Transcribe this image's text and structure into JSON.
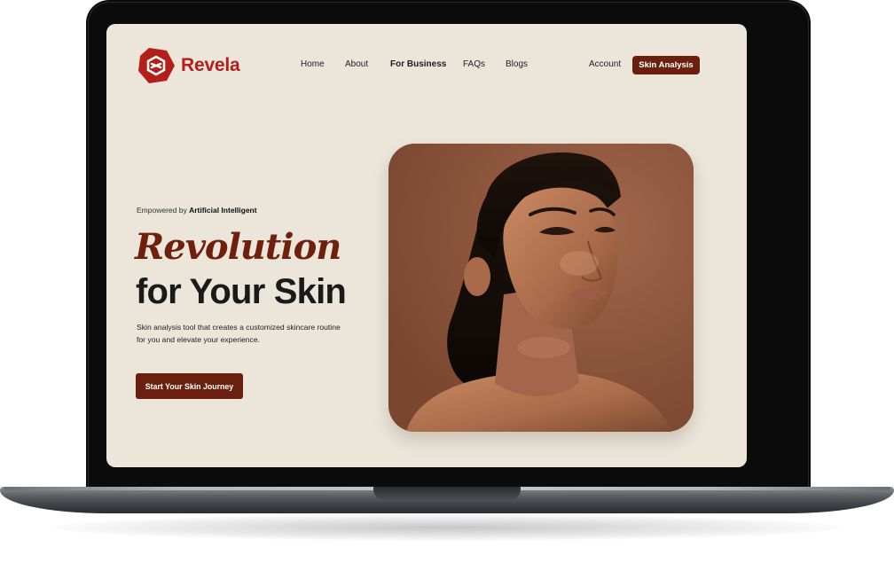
{
  "brand": {
    "name": "Revela",
    "color": "#b41f1a"
  },
  "nav": {
    "items": [
      {
        "label": "Home",
        "active": false
      },
      {
        "label": "About",
        "active": false
      },
      {
        "label": "For Business",
        "active": true
      },
      {
        "label": "FAQs",
        "active": false
      },
      {
        "label": "Blogs",
        "active": false
      }
    ],
    "account_label": "Account",
    "skin_analysis_label": "Skin Analysis"
  },
  "hero": {
    "tagline_prefix": "Empowered by ",
    "tagline_bold": "Artificial Intelligent",
    "headline_line1": "Revolution",
    "headline_line2": "for Your Skin",
    "description": "Skin analysis tool that creates a customized skincare routine for you and elevate your experience.",
    "cta_label": "Start Your Skin Journey"
  },
  "theme": {
    "accent": "#6b1f0f",
    "background": "#ebe5da",
    "portrait_bg": "#8a5338"
  }
}
